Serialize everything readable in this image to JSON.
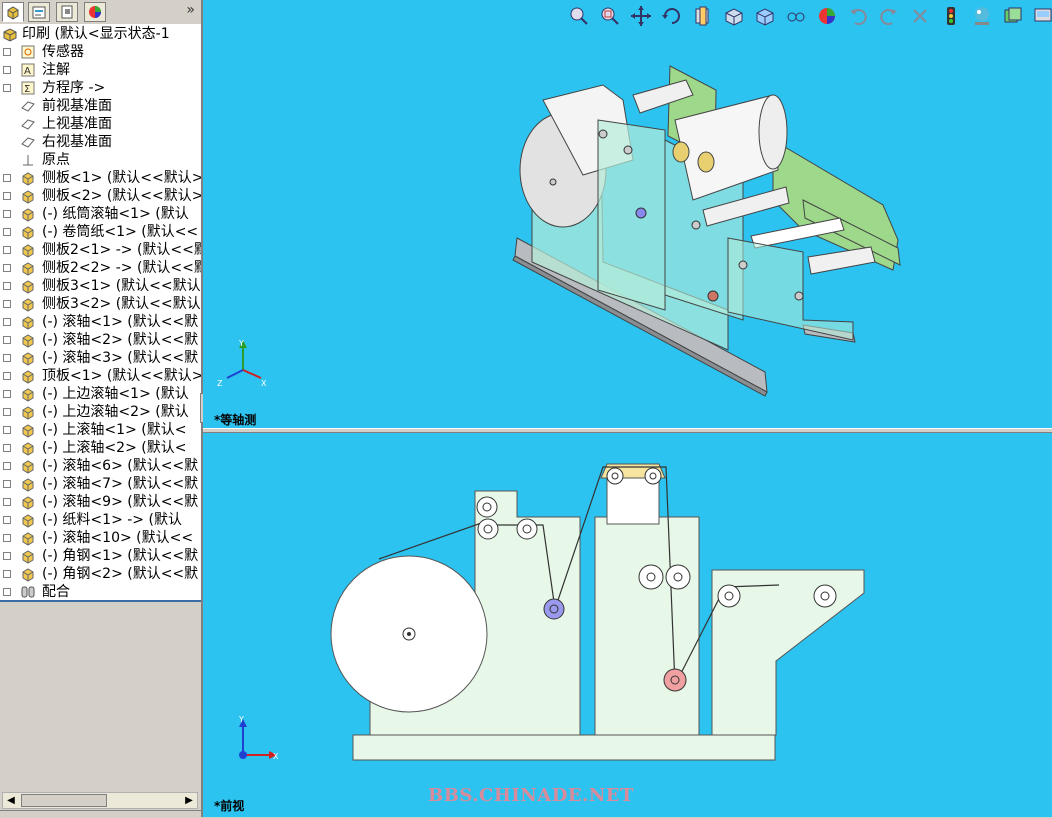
{
  "sidebar": {
    "more_label": "»",
    "tree": [
      {
        "label": "印刷  (默认<显示状态-1",
        "icon": "part-assembly-icon",
        "root": true
      },
      {
        "label": "传感器",
        "icon": "sensor-icon"
      },
      {
        "label": "注解",
        "icon": "annotation-icon"
      },
      {
        "label": "方程序 ->",
        "icon": "equation-icon"
      },
      {
        "label": "前视基准面",
        "icon": "plane-icon"
      },
      {
        "label": "上视基准面",
        "icon": "plane-icon"
      },
      {
        "label": "右视基准面",
        "icon": "plane-icon"
      },
      {
        "label": "原点",
        "icon": "origin-icon"
      },
      {
        "label": "侧板<1> (默认<<默认>",
        "icon": "part-icon"
      },
      {
        "label": "侧板<2> (默认<<默认>",
        "icon": "part-icon"
      },
      {
        "label": "(-) 纸筒滚轴<1> (默认",
        "icon": "part-icon"
      },
      {
        "label": "(-) 卷筒纸<1> (默认<<",
        "icon": "part-icon"
      },
      {
        "label": "侧板2<1> -> (默认<<默",
        "icon": "part-icon"
      },
      {
        "label": "侧板2<2> -> (默认<<默",
        "icon": "part-icon"
      },
      {
        "label": "侧板3<1> (默认<<默认",
        "icon": "part-icon"
      },
      {
        "label": "侧板3<2> (默认<<默认",
        "icon": "part-icon"
      },
      {
        "label": "(-) 滚轴<1> (默认<<默",
        "icon": "part-icon"
      },
      {
        "label": "(-) 滚轴<2> (默认<<默",
        "icon": "part-icon"
      },
      {
        "label": "(-) 滚轴<3> (默认<<默",
        "icon": "part-icon"
      },
      {
        "label": "顶板<1> (默认<<默认>",
        "icon": "part-icon"
      },
      {
        "label": "(-) 上边滚轴<1> (默认",
        "icon": "part-icon"
      },
      {
        "label": "(-) 上边滚轴<2> (默认",
        "icon": "part-icon"
      },
      {
        "label": "(-) 上滚轴<1> (默认<",
        "icon": "part-icon"
      },
      {
        "label": "(-) 上滚轴<2> (默认<",
        "icon": "part-icon"
      },
      {
        "label": "(-) 滚轴<6> (默认<<默",
        "icon": "part-icon"
      },
      {
        "label": "(-) 滚轴<7> (默认<<默",
        "icon": "part-icon"
      },
      {
        "label": "(-) 滚轴<9> (默认<<默",
        "icon": "part-icon"
      },
      {
        "label": "(-) 纸料<1> -> (默认",
        "icon": "part-icon"
      },
      {
        "label": "(-) 滚轴<10> (默认<<",
        "icon": "part-icon"
      },
      {
        "label": "(-) 角钢<1> (默认<<默",
        "icon": "part-icon"
      },
      {
        "label": "(-) 角钢<2> (默认<<默",
        "icon": "part-icon"
      },
      {
        "label": "配合",
        "icon": "mates-icon"
      }
    ],
    "scroll_left": "◀",
    "scroll_right": "▶"
  },
  "toolbar": {
    "icons": [
      "zoom-to-fit-icon",
      "zoom-to-area-icon",
      "pan-icon",
      "rotate-icon",
      "section-view-icon",
      "view-orientation-icon",
      "display-style-icon",
      "hide-show-icon",
      "edit-appearance-icon",
      "undo-icon",
      "redo-icon",
      "close-icon",
      "traffic-light-icon",
      "apply-scene-icon",
      "display-pane-icon",
      "view-settings-icon",
      "triad-icon",
      "camera-icon",
      "scene-pattern-icon"
    ]
  },
  "views": {
    "top_label": "*等轴测",
    "bottom_label": "*前视"
  },
  "watermark": "BBS.CHINADE.NET",
  "colors": {
    "viewport_bg": "#2cc3f0",
    "panel_fill": "#e8f8e8",
    "roller_blue": "#8888ee",
    "roller_red": "#ee9999",
    "plate_green": "#9ed88a"
  }
}
